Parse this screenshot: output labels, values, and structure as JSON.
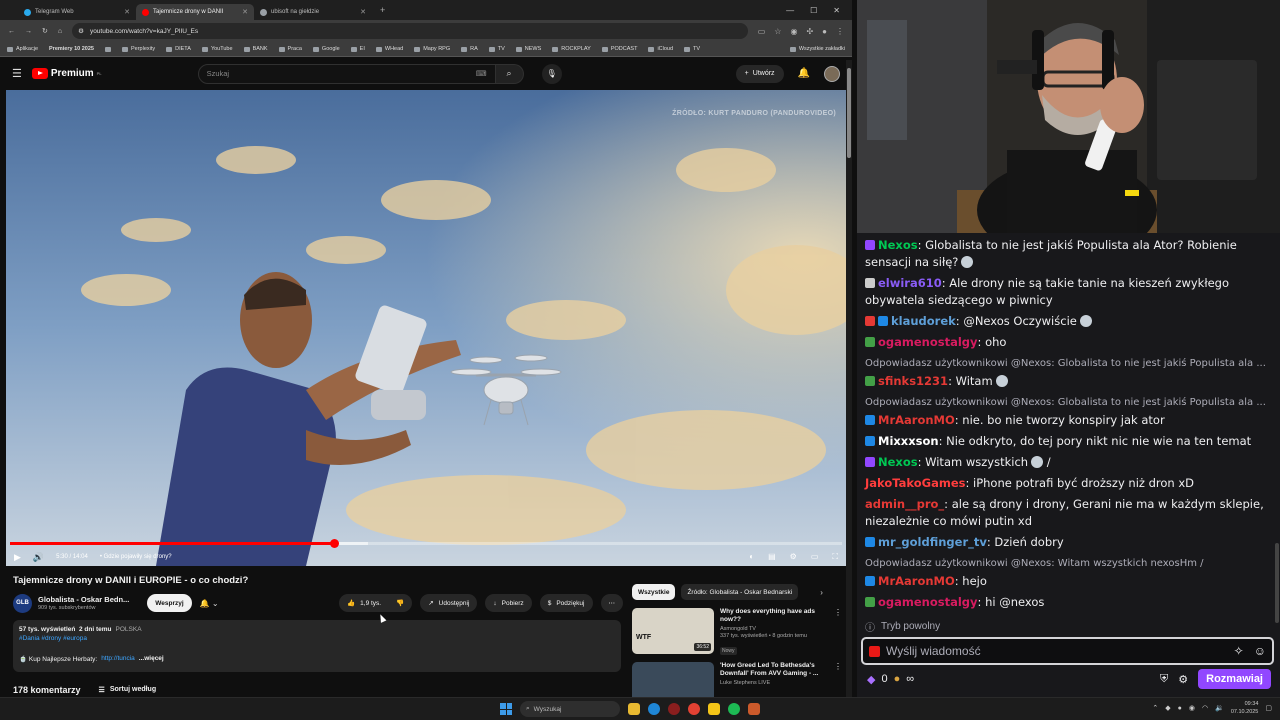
{
  "browser": {
    "tabs": [
      {
        "label": "Telegram Web",
        "color": "#2aabee"
      },
      {
        "label": "Tajemnicze drony w DANII",
        "color": "#ff0000"
      },
      {
        "label": "ubisoft na giełdzie",
        "color": "#9aa0a6"
      }
    ],
    "url": "youtube.com/watch?v=kaJY_PlIU_Es",
    "bookmarks": [
      "Aplikacje",
      "Premiery 10 2025",
      "Perplexity",
      "DIETA",
      "YouTube",
      "BANK",
      "Praca",
      "Google",
      "EI",
      "WHead",
      "Mapy RPG",
      "RA",
      "TV",
      "NEWS",
      "ROCKPLAY",
      "PODCAST",
      "iCloud",
      "TV"
    ],
    "bookmarks_all": "Wszystkie zakładki"
  },
  "youtube": {
    "logo": "Premium",
    "logo_sup": "PL",
    "search_placeholder": "Szukaj",
    "create_label": "Utwórz",
    "video": {
      "watermark": "ŹRÓDŁO: KURT PANDURO (PANDUROVIDEO)",
      "time": "5:30 / 14:04",
      "chapter": "• Gdzie pojawiły się drony?",
      "progress": 0.39
    },
    "title": "Tajemnicze drony w DANII i EUROPIE - o co chodzi?",
    "channel": {
      "name": "Globalista - Oskar Bedn...",
      "subs": "909 tys. subskrybentów",
      "avatar_text": "GLB"
    },
    "join_label": "Wesprzyj",
    "likes": "1,9 tys.",
    "share_label": "Udostępnij",
    "download_label": "Pobierz",
    "thanks_label": "Podziękuj",
    "description": {
      "views": "57 tys. wyświetleń",
      "date": "2 dni temu",
      "country": "POLSKA",
      "tags": "#Dania #drony #europa",
      "line": "🍵 Kup Najlepsze Herbaty:",
      "link": "http://tuncia",
      "more": "...więcej"
    },
    "comments_count": "178 komentarzy",
    "sort_label": "Sortuj według",
    "chips": [
      "Wszystkie",
      "Źródło: Globalista - Oskar Bednarski"
    ],
    "recommendations": [
      {
        "title": "Why does everything have ads now??",
        "channel": "Asmongold TV",
        "meta": "337 tys. wyświetleń • 8 godzin temu",
        "badge": "Nowy",
        "duration": "36:52",
        "thumb_color": "#d9d4c7",
        "thumb_text": "WTF"
      },
      {
        "title": "'How Greed Led To Bethesda's Downfall' From AVV Gaming - ...",
        "channel": "Luke Stephens LIVE",
        "meta": "",
        "badge": "",
        "duration": "",
        "thumb_color": "#3a4a5a",
        "thumb_text": ""
      }
    ]
  },
  "chat": {
    "messages": [
      {
        "reply": "",
        "badges": [
          "#9147ff"
        ],
        "user": "Nexos",
        "color": "#00c853",
        "text": ": Globalista to nie jest jakiś Populista ala Ator? Robienie sensacji na siłę?",
        "emote": true
      },
      {
        "reply": "",
        "badges": [
          "#cccccc"
        ],
        "user": "elwira610",
        "color": "#8a5cf6",
        "text": ": Ale drony nie są takie tanie na kieszeń zwykłego obywatela siedzącego w piwnicy",
        "emote": false
      },
      {
        "reply": "",
        "badges": [
          "#e53935",
          "#1e88e5"
        ],
        "user": "klaudorek",
        "color": "#5e9fd8",
        "text": ": @Nexos Oczywiście",
        "emote": true
      },
      {
        "reply": "",
        "badges": [
          "#43a047"
        ],
        "user": "ogamenostalgy",
        "color": "#d81b60",
        "text": ": oho",
        "emote": false
      },
      {
        "reply": "Odpowiadasz użytkownikowi @Nexos: Globalista to nie jest jakiś Populista ala ...",
        "badges": [
          "#43a047"
        ],
        "user": "sfinks1231",
        "color": "#e53935",
        "text": ": Witam",
        "emote": true
      },
      {
        "reply": "Odpowiadasz użytkownikowi @Nexos: Globalista to nie jest jakiś Populista ala ...",
        "badges": [
          "#1e88e5"
        ],
        "user": "MrAaronMO",
        "color": "#e53935",
        "text": ": nie. bo nie tworzy konspiry jak ator",
        "emote": false
      },
      {
        "reply": "",
        "badges": [
          "#1e88e5"
        ],
        "user": "Mixxxson",
        "color": "#ffffff",
        "text": ": Nie odkryto, do tej pory nikt nic nie wie na ten temat",
        "emote": false
      },
      {
        "reply": "",
        "badges": [
          "#9147ff"
        ],
        "user": "Nexos",
        "color": "#00c853",
        "text": ": Witam wszystkich",
        "emote": true,
        "suffix": " /"
      },
      {
        "reply": "",
        "badges": [],
        "user": "JakoTakoGames",
        "color": "#ff3d3d",
        "text": ": iPhone potrafi być droższy niż dron xD",
        "emote": false
      },
      {
        "reply": "",
        "badges": [],
        "user": "admin__pro_",
        "color": "#e53935",
        "text": ": ale są drony i drony, Gerani nie ma w każdym sklepie, niezależnie co mówi putin xd",
        "emote": false
      },
      {
        "reply": "",
        "badges": [
          "#1e88e5"
        ],
        "user": "mr_goldfinger_tv",
        "color": "#5e9fd8",
        "text": ": Dzień dobry",
        "emote": false
      },
      {
        "reply": "Odpowiadasz użytkownikowi @Nexos: Witam wszystkich nexosHm /",
        "badges": [
          "#1e88e5"
        ],
        "user": "MrAaronMO",
        "color": "#e53935",
        "text": ": hejo",
        "emote": false
      },
      {
        "reply": "",
        "badges": [
          "#43a047"
        ],
        "user": "ogamenostalgy",
        "color": "#d81b60",
        "text": ": hi @nexos",
        "emote": false
      }
    ],
    "slow_mode": "Tryb powolny",
    "input_placeholder": "Wyślij wiadomość",
    "points": "0",
    "infinity": "∞",
    "chat_button": "Rozmawiaj"
  },
  "taskbar": {
    "search_placeholder": "Wyszukaj",
    "time": "09:34",
    "date": "07.10.2025"
  }
}
